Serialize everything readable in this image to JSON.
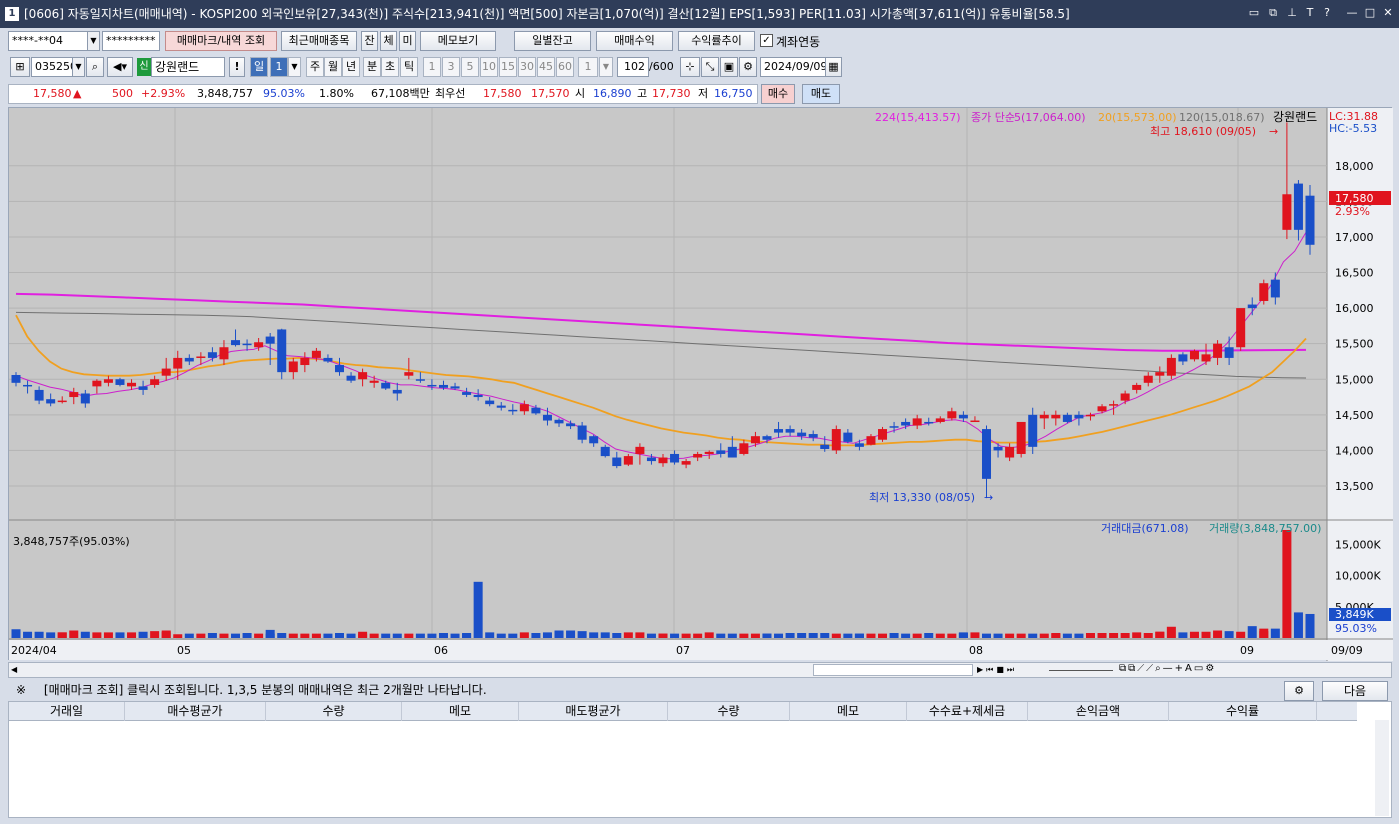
{
  "window": {
    "number": "1",
    "title": "[0606] 자동일지차트(매매내역) - KOSPI200 외국인보유[27,343(천)] 주식수[213,941(천)] 액면[500] 자본금[1,070(억)] 결산[12월] EPS[1,593] PER[11.03] 시가총액[37,611(억)] 유통비율[58.5]"
  },
  "toolbar1": {
    "account": "****-**04",
    "password": "*********",
    "btn_mark": "매매마크/내역 조회",
    "btn_recent": "최근매매종목",
    "t_jan": "잔",
    "t_che": "체",
    "t_mi": "미",
    "btn_memo": "메모보기",
    "btn_daily": "일별잔고",
    "btn_profit": "매매수익",
    "btn_return": "수익률추이",
    "chk_link": "계좌연동"
  },
  "toolbar2": {
    "code": "035250",
    "badge": "신",
    "name": "강원랜드",
    "period_labels": [
      "일",
      "1",
      "주",
      "월",
      "년",
      "분",
      "초",
      "틱"
    ],
    "minute_labels": [
      "1",
      "3",
      "5",
      "10",
      "15",
      "30",
      "45",
      "60",
      "1"
    ],
    "count": "102",
    "count_max": "/600",
    "date": "2024/09/09"
  },
  "quote": {
    "price": "17,580",
    "arrow": "▲",
    "change": "500",
    "rate": "+2.93%",
    "volume": "3,848,757",
    "vol_rate": "95.03%",
    "turnover": "1.80%",
    "amount": "67,108백만",
    "best_label": "최우선",
    "ask": "17,580",
    "bid": "17,570",
    "open_label": "시",
    "open": "16,890",
    "high_label": "고",
    "high": "17,730",
    "low_label": "저",
    "low": "16,750",
    "buy": "매수",
    "sell": "매도"
  },
  "chart_data": {
    "type": "candlestick",
    "legend": {
      "ma224": "224(15,413.57)",
      "close_simple": "종가 단순",
      "ma5": "5(17,064.00)",
      "ma20": "20(15,573.00)",
      "ma120": "120(15,018.67)",
      "stock": "강원랜드"
    },
    "lc": "LC:31.88",
    "hc": "HC:-5.53",
    "high_note": "최고 18,610 (09/05)",
    "low_note": "최저 13,330 (08/05)",
    "price_ticks": [
      "18,000",
      "17,500",
      "17,000",
      "16,500",
      "16,000",
      "15,500",
      "15,000",
      "14,500",
      "14,000",
      "13,500"
    ],
    "price_values": [
      18000,
      17500,
      17000,
      16500,
      16000,
      15500,
      15000,
      14500,
      14000,
      13500
    ],
    "ylim": [
      13050,
      18700
    ],
    "current_price": "17,580",
    "current_rate": "2.93%",
    "x_labels": [
      "2024/04",
      "05",
      "06",
      "07",
      "08",
      "09",
      "09/09"
    ],
    "candles": [
      [
        15060,
        15100,
        14900,
        14950
      ],
      [
        14920,
        14980,
        14800,
        14900
      ],
      [
        14850,
        14900,
        14650,
        14700
      ],
      [
        14720,
        14800,
        14620,
        14660
      ],
      [
        14700,
        14760,
        14660,
        14700
      ],
      [
        14750,
        14880,
        14650,
        14820
      ],
      [
        14800,
        14850,
        14600,
        14660
      ],
      [
        14900,
        15000,
        14800,
        14980
      ],
      [
        14950,
        15050,
        14900,
        15000
      ],
      [
        15000,
        15020,
        14900,
        14920
      ],
      [
        14900,
        15000,
        14850,
        14950
      ],
      [
        14900,
        14980,
        14780,
        14850
      ],
      [
        14920,
        15050,
        14880,
        15000
      ],
      [
        15050,
        15300,
        14980,
        15150
      ],
      [
        15150,
        15400,
        14990,
        15300
      ],
      [
        15300,
        15350,
        15200,
        15250
      ],
      [
        15300,
        15380,
        15200,
        15320
      ],
      [
        15380,
        15450,
        15250,
        15300
      ],
      [
        15280,
        15550,
        15200,
        15450
      ],
      [
        15550,
        15700,
        15460,
        15480
      ],
      [
        15500,
        15560,
        15400,
        15480
      ],
      [
        15450,
        15580,
        15400,
        15520
      ],
      [
        15600,
        15650,
        15200,
        15500
      ],
      [
        15700,
        15710,
        15000,
        15100
      ],
      [
        15100,
        15300,
        15000,
        15250
      ],
      [
        15200,
        15380,
        15100,
        15300
      ],
      [
        15300,
        15440,
        15250,
        15400
      ],
      [
        15300,
        15350,
        15230,
        15250
      ],
      [
        15200,
        15300,
        15050,
        15100
      ],
      [
        15050,
        15100,
        14950,
        14980
      ],
      [
        15000,
        15150,
        14900,
        15100
      ],
      [
        14950,
        15050,
        14880,
        14980
      ],
      [
        14950,
        14980,
        14850,
        14870
      ],
      [
        14850,
        14950,
        14700,
        14800
      ],
      [
        15050,
        15300,
        15000,
        15100
      ],
      [
        15000,
        15100,
        14950,
        14980
      ],
      [
        14920,
        15000,
        14850,
        14900
      ],
      [
        14920,
        14980,
        14850,
        14880
      ],
      [
        14900,
        14950,
        14850,
        14870
      ],
      [
        14820,
        14880,
        14750,
        14780
      ],
      [
        14780,
        14860,
        14700,
        14750
      ],
      [
        14700,
        14750,
        14620,
        14650
      ],
      [
        14630,
        14680,
        14560,
        14600
      ],
      [
        14570,
        14650,
        14500,
        14550
      ],
      [
        14550,
        14700,
        14500,
        14650
      ],
      [
        14600,
        14640,
        14500,
        14520
      ],
      [
        14500,
        14600,
        14350,
        14420
      ],
      [
        14430,
        14450,
        14330,
        14380
      ],
      [
        14380,
        14420,
        14300,
        14340
      ],
      [
        14350,
        14400,
        14100,
        14150
      ],
      [
        14200,
        14220,
        14050,
        14100
      ],
      [
        14050,
        14080,
        13900,
        13920
      ],
      [
        13900,
        13980,
        13750,
        13780
      ],
      [
        13800,
        13950,
        13780,
        13920
      ],
      [
        13950,
        14100,
        13800,
        14050
      ],
      [
        13900,
        13950,
        13800,
        13850
      ],
      [
        13820,
        13950,
        13770,
        13900
      ],
      [
        13950,
        14000,
        13800,
        13830
      ],
      [
        13800,
        13880,
        13750,
        13850
      ],
      [
        13900,
        13980,
        13850,
        13950
      ],
      [
        13950,
        14000,
        13880,
        13980
      ],
      [
        14000,
        14100,
        13900,
        13950
      ],
      [
        14050,
        14200,
        13900,
        13900
      ],
      [
        13950,
        14150,
        13930,
        14100
      ],
      [
        14100,
        14260,
        14050,
        14200
      ],
      [
        14200,
        14220,
        14100,
        14150
      ],
      [
        14300,
        14400,
        14180,
        14250
      ],
      [
        14300,
        14350,
        14200,
        14250
      ],
      [
        14250,
        14300,
        14150,
        14200
      ],
      [
        14230,
        14280,
        14130,
        14180
      ],
      [
        14080,
        14200,
        13980,
        14020
      ],
      [
        14000,
        14350,
        13950,
        14300
      ],
      [
        14250,
        14300,
        14100,
        14120
      ],
      [
        14100,
        14150,
        14000,
        14050
      ],
      [
        14080,
        14230,
        14070,
        14200
      ],
      [
        14150,
        14330,
        14120,
        14300
      ],
      [
        14340,
        14400,
        14250,
        14320
      ],
      [
        14400,
        14450,
        14300,
        14350
      ],
      [
        14350,
        14500,
        14300,
        14450
      ],
      [
        14400,
        14460,
        14350,
        14380
      ],
      [
        14400,
        14480,
        14380,
        14450
      ],
      [
        14450,
        14600,
        14420,
        14550
      ],
      [
        14500,
        14550,
        14400,
        14450
      ],
      [
        14400,
        14480,
        14420,
        14420
      ],
      [
        14300,
        14350,
        13330,
        13600
      ],
      [
        14050,
        14100,
        13900,
        14000
      ],
      [
        13900,
        14100,
        13850,
        14050
      ],
      [
        13950,
        14300,
        13900,
        14400
      ],
      [
        14500,
        14600,
        13950,
        14050
      ],
      [
        14450,
        14550,
        14300,
        14500
      ],
      [
        14450,
        14560,
        14350,
        14500
      ],
      [
        14500,
        14530,
        14380,
        14400
      ],
      [
        14500,
        14550,
        14350,
        14450
      ],
      [
        14500,
        14530,
        14420,
        14500
      ],
      [
        14550,
        14650,
        14520,
        14620
      ],
      [
        14650,
        14700,
        14500,
        14650
      ],
      [
        14700,
        14840,
        14650,
        14800
      ],
      [
        14850,
        14950,
        14800,
        14920
      ],
      [
        14950,
        15100,
        14900,
        15050
      ],
      [
        15050,
        15180,
        14950,
        15100
      ],
      [
        15050,
        15350,
        15000,
        15300
      ],
      [
        15350,
        15380,
        15200,
        15250
      ],
      [
        15280,
        15420,
        15250,
        15400
      ],
      [
        15250,
        15500,
        15200,
        15350
      ],
      [
        15300,
        15550,
        15200,
        15500
      ],
      [
        15450,
        15600,
        15200,
        15300
      ],
      [
        15450,
        15700,
        15400,
        16000
      ],
      [
        16050,
        16150,
        15900,
        16000
      ],
      [
        16100,
        16400,
        16050,
        16350
      ],
      [
        16400,
        16500,
        16050,
        16150
      ],
      [
        17100,
        18610,
        16970,
        17600
      ],
      [
        17750,
        17800,
        16950,
        17100
      ],
      [
        17580,
        17730,
        16750,
        16890
      ]
    ],
    "ma5": [
      15050,
      14990,
      14940,
      14890,
      14860,
      14820,
      14760,
      14790,
      14800,
      14830,
      14850,
      14880,
      14930,
      14970,
      15020,
      15100,
      15190,
      15260,
      15340,
      15390,
      15410,
      15420,
      15470,
      15400,
      15330,
      15320,
      15300,
      15280,
      15240,
      15180,
      15120,
      15050,
      15000,
      14950,
      14920,
      14920,
      14900,
      14880,
      14870,
      14850,
      14820,
      14790,
      14760,
      14720,
      14680,
      14650,
      14600,
      14550,
      14470,
      14390,
      14310,
      14230,
      14120,
      14020,
      13980,
      13950,
      13920,
      13890,
      13880,
      13890,
      13920,
      13930,
      13950,
      13990,
      14020,
      14060,
      14110,
      14170,
      14200,
      14200,
      14180,
      14170,
      14140,
      14120,
      14100,
      14150,
      14200,
      14250,
      14300,
      14350,
      14360,
      14390,
      14420,
      14430,
      14400,
      14300,
      14160,
      14060,
      14040,
      14060,
      14120,
      14200,
      14300,
      14390,
      14470,
      14500,
      14530,
      14590,
      14680,
      14740,
      14820,
      14910,
      14980,
      15050,
      15130,
      15220,
      15350,
      15500,
      15700,
      15900,
      16100,
      16350,
      16650,
      16800,
      17064
    ],
    "ma20": [
      15900,
      15600,
      15400,
      15250,
      15150,
      15100,
      15070,
      15060,
      15050,
      15050,
      15050,
      15060,
      15080,
      15100,
      15100,
      15120,
      15150,
      15180,
      15200,
      15230,
      15260,
      15270,
      15280,
      15290,
      15290,
      15300,
      15290,
      15280,
      15250,
      15220,
      15200,
      15190,
      15170,
      15160,
      15150,
      15120,
      15100,
      15080,
      15060,
      15050,
      15040,
      15020,
      15000,
      14970,
      14950,
      14900,
      14850,
      14800,
      14750,
      14700,
      14650,
      14600,
      14540,
      14480,
      14430,
      14390,
      14350,
      14310,
      14280,
      14250,
      14230,
      14210,
      14180,
      14160,
      14150,
      14130,
      14120,
      14110,
      14100,
      14090,
      14080,
      14080,
      14070,
      14070,
      14070,
      14080,
      14090,
      14100,
      14110,
      14120,
      14120,
      14130,
      14140,
      14150,
      14150,
      14130,
      14120,
      14110,
      14110,
      14110,
      14120,
      14130,
      14150,
      14170,
      14200,
      14230,
      14260,
      14300,
      14340,
      14380,
      14420,
      14460,
      14500,
      14550,
      14600,
      14650,
      14700,
      14760,
      14830,
      14900,
      15000,
      15100,
      15250,
      15400,
      15573
    ],
    "ma120": [
      15940,
      15935,
      15930,
      15925,
      15920,
      15915,
      15910,
      15905,
      15900,
      15890,
      15880,
      15860,
      15840,
      15820,
      15800,
      15780,
      15760,
      15740,
      15720,
      15700,
      15680,
      15660,
      15640,
      15620,
      15600,
      15580,
      15560,
      15540,
      15520,
      15500,
      15480,
      15460,
      15440,
      15420,
      15400,
      15380,
      15360,
      15340,
      15320,
      15300,
      15280,
      15260,
      15240,
      15220,
      15200,
      15180,
      15160,
      15140,
      15120,
      15100,
      15080,
      15060,
      15040,
      15030,
      15020,
      15018
    ],
    "ma224": [
      16200,
      16190,
      16170,
      16150,
      16130,
      16110,
      16090,
      16070,
      16050,
      16020,
      15990,
      15960,
      15930,
      15900,
      15870,
      15840,
      15810,
      15780,
      15750,
      15720,
      15690,
      15660,
      15630,
      15600,
      15570,
      15540,
      15510,
      15490,
      15470,
      15450,
      15430,
      15410,
      15400,
      15400,
      15405,
      15410,
      15413
    ],
    "volume": {
      "legend_amount": "거래대금(671.08)",
      "legend_volume": "거래량(3,848,757.00)",
      "top_left": "3,848,757주(95.03%)",
      "ticks": [
        "15,000K",
        "10,000K",
        "5,000K"
      ],
      "tick_values": [
        15000,
        10000,
        5000
      ],
      "current": "3,849K",
      "current_rate": "95.03%",
      "max": 17300,
      "values": [
        1400,
        1000,
        1000,
        900,
        900,
        900,
        1200,
        1000,
        900,
        900,
        900,
        900,
        1000,
        1100,
        1200,
        1000,
        600,
        700,
        700,
        800,
        700,
        700,
        800,
        700,
        700,
        1300,
        800,
        700,
        700,
        700,
        700,
        800,
        700,
        700,
        1000,
        700,
        700,
        700,
        700,
        700,
        700,
        800,
        700,
        700,
        800,
        9000,
        900,
        700,
        700,
        900,
        800,
        900,
        1000,
        1200,
        1200,
        1100,
        900,
        900,
        800,
        900,
        900,
        700,
        700,
        700,
        700,
        700,
        700,
        900,
        700,
        700,
        700,
        700,
        700,
        700,
        700,
        800,
        800,
        800,
        800,
        700,
        700,
        700,
        700,
        700,
        700,
        800,
        700,
        700,
        800,
        700,
        700,
        800,
        900,
        900,
        700,
        700,
        700,
        700,
        700,
        700,
        800,
        700,
        700,
        700,
        800,
        800,
        800,
        800,
        900,
        800,
        1000,
        1000,
        1800,
        900,
        1000,
        1000,
        1200,
        1100,
        1000,
        1900,
        1100,
        1500,
        1500,
        17300,
        4100,
        3849
      ]
    }
  },
  "bottom": {
    "notice_mark": "※",
    "notice": "[매매마크 조회] 클릭시 조회됩니다. 1,3,5 분봉의 매매내역은 최근 2개월만 나타납니다.",
    "next": "다음"
  },
  "table": {
    "headers": [
      "거래일",
      "매수평균가",
      "수량",
      "메모",
      "매도평균가",
      "수량",
      "메모",
      "수수료+제세금",
      "손익금액",
      "수익률"
    ]
  },
  "colors": {
    "up": "#e0141e",
    "down": "#1a4fc8",
    "ma5": "#cc1fcc",
    "ma20": "#f0a020",
    "ma120": "#707070",
    "ma224": "#e020e0",
    "title_bg": "#2f3d59"
  }
}
